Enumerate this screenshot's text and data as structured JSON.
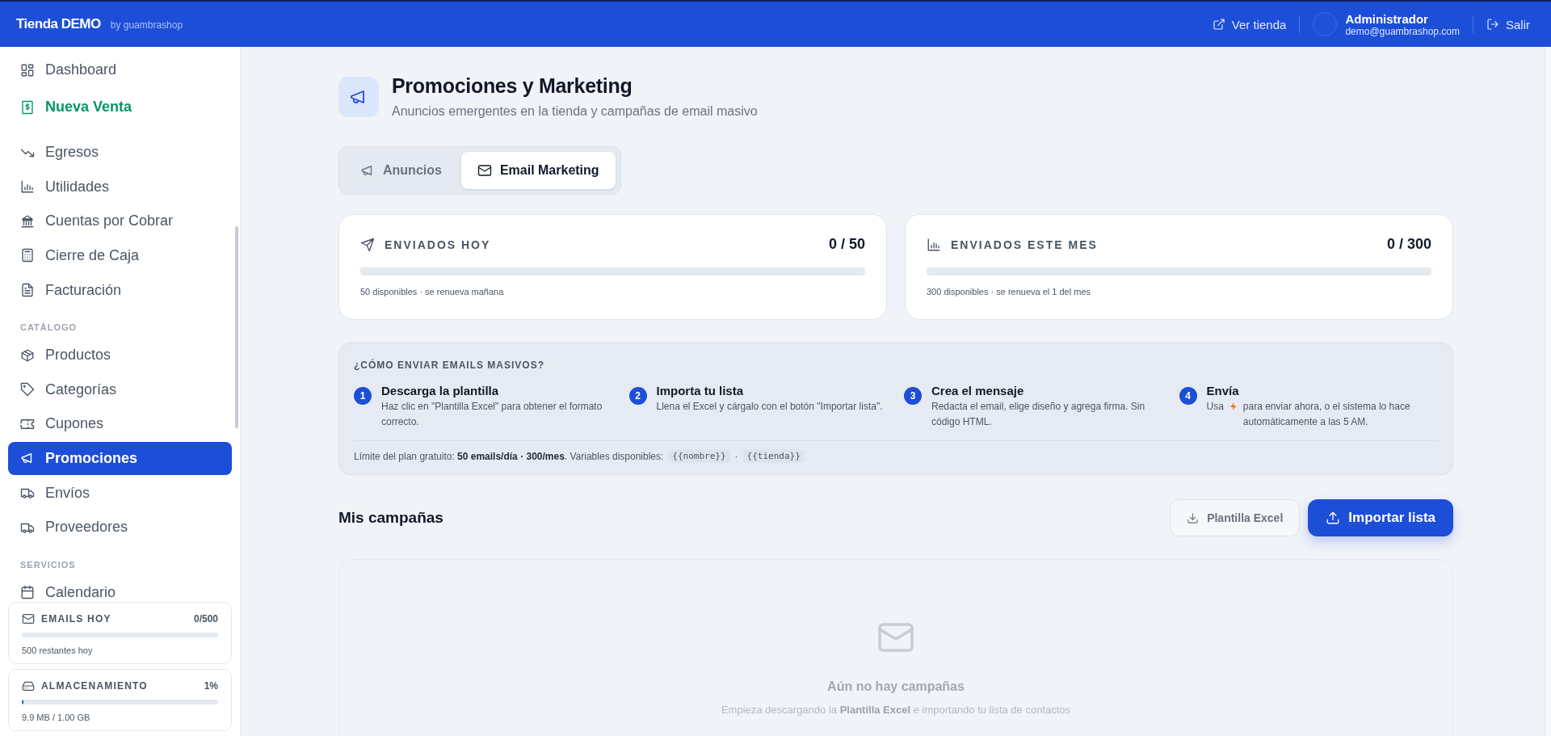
{
  "topbar": {
    "brand": "Tienda DEMO",
    "brand_sub": "by guambrashop",
    "view_store": "Ver tienda",
    "user": {
      "name": "Administrador",
      "email": "demo@guambrashop.com"
    },
    "logout": "Salir"
  },
  "sidebar": {
    "sections": [
      {
        "items": [
          {
            "label": "Dashboard",
            "kind": "link",
            "selected": false
          },
          {
            "label": "Nueva Venta",
            "kind": "highlight",
            "selected": false
          }
        ]
      },
      {
        "items": [
          {
            "label": "Egresos",
            "kind": "link",
            "selected": false
          },
          {
            "label": "Utilidades",
            "kind": "link",
            "selected": false
          },
          {
            "label": "Cuentas por Cobrar",
            "kind": "link",
            "selected": false
          },
          {
            "label": "Cierre de Caja",
            "kind": "link",
            "selected": false
          },
          {
            "label": "Facturación",
            "kind": "link",
            "selected": false
          }
        ]
      },
      {
        "label": "CATÁLOGO",
        "items": [
          {
            "label": "Productos",
            "kind": "link",
            "selected": false
          },
          {
            "label": "Categorías",
            "kind": "link",
            "selected": false
          },
          {
            "label": "Cupones",
            "kind": "link",
            "selected": false
          },
          {
            "label": "Promociones",
            "kind": "link",
            "selected": true
          },
          {
            "label": "Envíos",
            "kind": "link",
            "selected": false
          },
          {
            "label": "Proveedores",
            "kind": "link",
            "selected": false
          }
        ]
      },
      {
        "label": "SERVICIOS",
        "items": [
          {
            "label": "Calendario",
            "kind": "link",
            "selected": false
          }
        ]
      }
    ],
    "usage": [
      {
        "title": "EMAILS HOY",
        "value": "0/500",
        "level": 0,
        "note": "500 restantes hoy"
      },
      {
        "title": "ALMACENAMIENTO",
        "value": "1%",
        "level": 0.01,
        "note": "9.9 MB / 1.00 GB"
      }
    ]
  },
  "page": {
    "title": "Promociones y Marketing",
    "subtitle": "Anuncios emergentes en la tienda y campañas de email masivo"
  },
  "tabs": [
    {
      "label": "Anuncios",
      "selected": false
    },
    {
      "label": "Email Marketing",
      "selected": true
    }
  ],
  "stats": [
    {
      "title": "ENVIADOS HOY",
      "value": "0 / 50",
      "level": 0,
      "note": "50 disponibles · se renueva mañana"
    },
    {
      "title": "ENVIADOS ESTE MES",
      "value": "0 / 300",
      "level": 0,
      "note": "300 disponibles · se renueva el 1 del mes"
    }
  ],
  "guide": {
    "title": "¿CÓMO ENVIAR EMAILS MASIVOS?",
    "steps": [
      {
        "number": "1",
        "title": "Descarga la plantilla",
        "text": "Haz clic en \"Plantilla Excel\" para obtener el formato correcto."
      },
      {
        "number": "2",
        "title": "Importa tu lista",
        "text": "Llena el Excel y cárgalo con el botón \"Importar lista\"."
      },
      {
        "number": "3",
        "title": "Crea el mensaje",
        "text": "Redacta el email, elige diseño y agrega firma. Sin código HTML."
      },
      {
        "number": "4",
        "title": "Envía",
        "text": "Usa",
        "text_after": "para enviar ahora, o el sistema lo hace automáticamente a las 5 AM."
      }
    ],
    "footer": "Límite del plan gratuito: **50 emails/día · 300/mes**. Variables disponibles:",
    "variables": [
      "{{nombre}}",
      "{{tienda}}"
    ],
    "separator": "·"
  },
  "campaigns": {
    "title": "Mis campañas",
    "buttons": [
      {
        "label": "Plantilla Excel",
        "kind": "secondary"
      },
      {
        "label": "Importar lista",
        "kind": "primary"
      }
    ],
    "empty": {
      "title": "Aún no hay campañas",
      "text": "Empieza descargando la **Plantilla Excel** e importando tu lista de contactos"
    }
  }
}
